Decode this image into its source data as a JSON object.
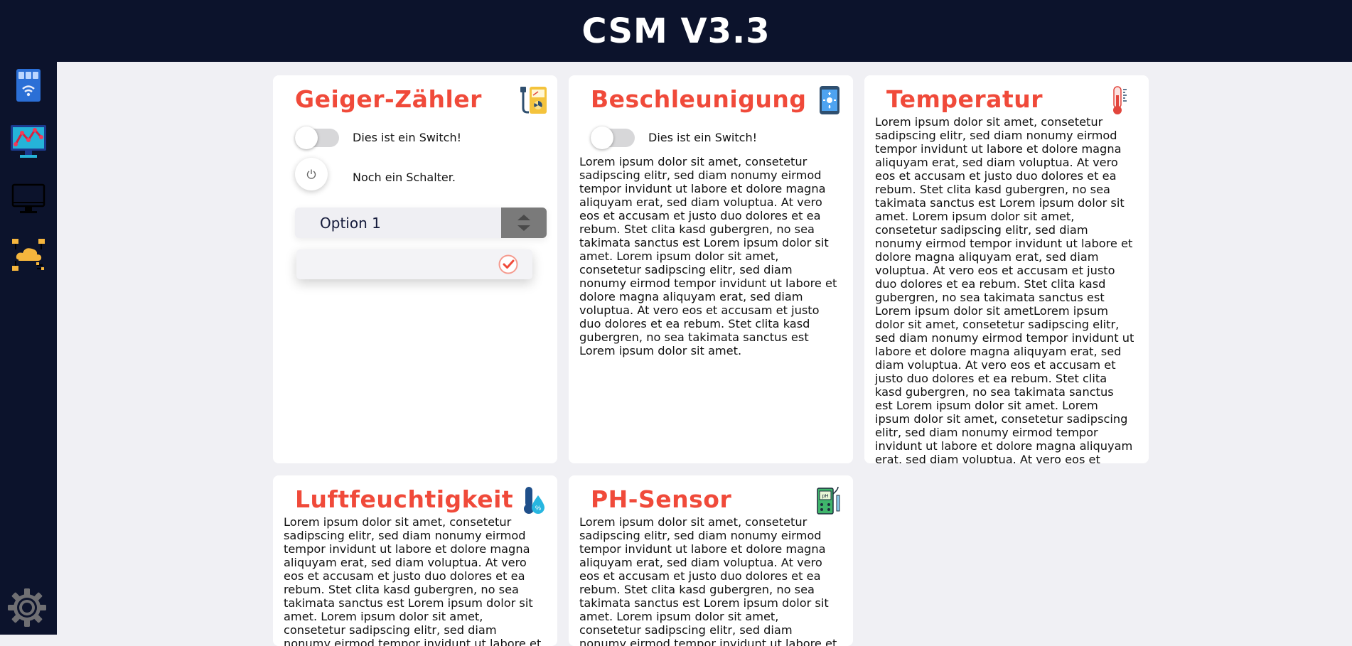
{
  "header": {
    "title": "CSM V3.3"
  },
  "sidebar": {
    "items": [
      {
        "name": "device-dashboard"
      },
      {
        "name": "chart-monitor"
      },
      {
        "name": "monitor"
      },
      {
        "name": "cloud-network"
      }
    ],
    "settings": {
      "name": "settings"
    }
  },
  "cards": {
    "geiger": {
      "title": "Geiger-Zähler",
      "switch_label": "Dies ist ein Switch!",
      "switch_on": false,
      "power_label": "Noch ein Schalter.",
      "select_value": "Option 1",
      "checkbox_checked": true
    },
    "accel": {
      "title": "Beschleunigung",
      "switch_label": "Dies ist ein Switch!",
      "switch_on": false,
      "text": "Lorem ipsum dolor sit amet, consetetur sadipscing elitr, sed diam nonumy eirmod tempor invidunt ut labore et dolore magna aliquyam erat, sed diam voluptua. At vero eos et accusam et justo duo dolores et ea rebum. Stet clita kasd gubergren, no sea takimata sanctus est Lorem ipsum dolor sit amet. Lorem ipsum dolor sit amet, consetetur sadipscing elitr, sed diam nonumy eirmod tempor invidunt ut labore et dolore magna aliquyam erat, sed diam voluptua. At vero eos et accusam et justo duo dolores et ea rebum. Stet clita kasd gubergren, no sea takimata sanctus est Lorem ipsum dolor sit amet."
    },
    "temp": {
      "title": "Temperatur",
      "text": "Lorem ipsum dolor sit amet, consetetur sadipscing elitr, sed diam nonumy eirmod tempor invidunt ut labore et dolore magna aliquyam erat, sed diam voluptua. At vero eos et accusam et justo duo dolores et ea rebum. Stet clita kasd gubergren, no sea takimata sanctus est Lorem ipsum dolor sit amet. Lorem ipsum dolor sit amet, consetetur sadipscing elitr, sed diam nonumy eirmod tempor invidunt ut labore et dolore magna aliquyam erat, sed diam voluptua. At vero eos et accusam et justo duo dolores et ea rebum. Stet clita kasd gubergren, no sea takimata sanctus est Lorem ipsum dolor sit ametLorem ipsum dolor sit amet, consetetur sadipscing elitr, sed diam nonumy eirmod tempor invidunt ut labore et dolore magna aliquyam erat, sed diam voluptua. At vero eos et accusam et justo duo dolores et ea rebum. Stet clita kasd gubergren, no sea takimata sanctus est Lorem ipsum dolor sit amet. Lorem ipsum dolor sit amet, consetetur sadipscing elitr, sed diam nonumy eirmod tempor invidunt ut labore et dolore magna aliquyam erat, sed diam voluptua. At vero eos et accusam et justo duo dolores et ea rebum. Stet clita kasd gubergren, no sea takimata sanctus est Lorem ipsum dolor sit amet."
    },
    "humidity": {
      "title": "Luftfeuchtigkeit",
      "text": "Lorem ipsum dolor sit amet, consetetur sadipscing elitr, sed diam nonumy eirmod tempor invidunt ut labore et dolore magna aliquyam erat, sed diam voluptua. At vero eos et accusam et justo duo dolores et ea rebum. Stet clita kasd gubergren, no sea takimata sanctus est Lorem ipsum dolor sit amet. Lorem ipsum dolor sit amet, consetetur sadipscing elitr, sed diam nonumy eirmod tempor invidunt ut labore et dolore magna aliquyam erat, sed diam voluptua."
    },
    "ph": {
      "title": "PH-Sensor",
      "text": "Lorem ipsum dolor sit amet, consetetur sadipscing elitr, sed diam nonumy eirmod tempor invidunt ut labore et dolore magna aliquyam erat, sed diam voluptua. At vero eos et accusam et justo duo dolores et ea rebum. Stet clita kasd gubergren, no sea takimata sanctus est Lorem ipsum dolor sit amet. Lorem ipsum dolor sit amet, consetetur sadipscing elitr, sed diam nonumy eirmod tempor invidunt ut labore et dolore magna aliquyam erat, sed diam voluptua."
    }
  },
  "colors": {
    "navy": "#0c132c",
    "accent": "#f04a3a",
    "background": "#f0f0f4"
  }
}
